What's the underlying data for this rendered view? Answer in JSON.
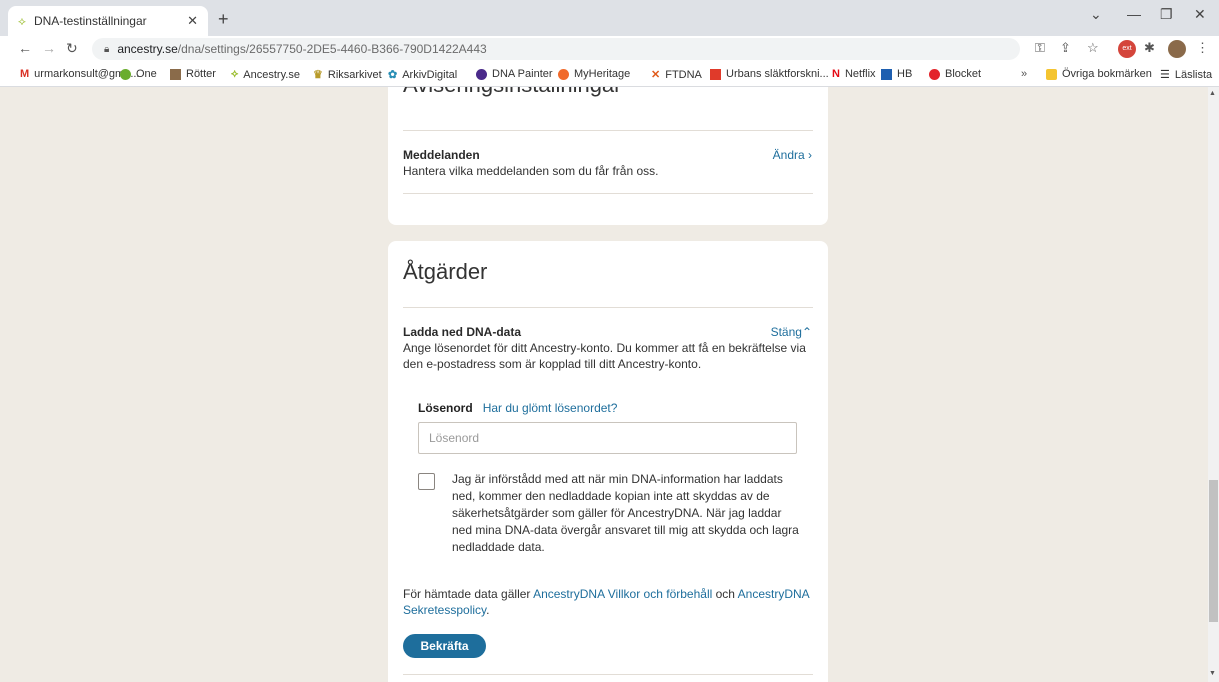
{
  "browser": {
    "tab_title": "DNA-testinställningar",
    "tab_favicon": "ancestry-leaf-icon",
    "url_host": "ancestry.se",
    "url_path": "/dna/settings/26557750-2DE5-4460-B366-790D1422A443",
    "bookmarks": [
      {
        "label": "urmarkonsult@gma...",
        "icon": "gmail-icon",
        "color": "#d93025"
      },
      {
        "label": "One",
        "icon": "circle-icon",
        "color": "#6aad2d"
      },
      {
        "label": "Rötter",
        "icon": "image-icon",
        "color": "#8a6b4a"
      },
      {
        "label": "Ancestry.se",
        "icon": "ancestry-leaf-icon",
        "color": "#9cbe30"
      },
      {
        "label": "Riksarkivet",
        "icon": "crown-icon",
        "color": "#b89b2a"
      },
      {
        "label": "ArkivDigital",
        "icon": "globe-icon",
        "color": "#2a8fb5"
      },
      {
        "label": "DNA Painter",
        "icon": "p-icon",
        "color": "#4a2a8a"
      },
      {
        "label": "MyHeritage",
        "icon": "myheritage-icon",
        "color": "#f16a2b"
      },
      {
        "label": "FTDNA",
        "icon": "ftdna-icon",
        "color": "#e05a1a"
      },
      {
        "label": "Urbans släktforskni...",
        "icon": "map-pin-icon",
        "color": "#e03a2a"
      },
      {
        "label": "Netflix",
        "icon": "netflix-icon",
        "color": "#e50914"
      },
      {
        "label": "HB",
        "icon": "hb-icon",
        "color": "#1e5fb0"
      },
      {
        "label": "Blocket",
        "icon": "blocket-icon",
        "color": "#e3242b"
      }
    ],
    "bookmarks_overflow": "»",
    "other_bookmarks": "Övriga bokmärken",
    "reading_list": "Läslista"
  },
  "notifications_section": {
    "heading": "Aviseringsinställningar",
    "row_title": "Meddelanden",
    "row_desc": "Hantera vilka meddelanden som du får från oss.",
    "row_action": "Ändra ›"
  },
  "actions_section": {
    "heading": "Åtgärder",
    "row_title": "Ladda ned DNA-data",
    "row_action": "Stäng⌃",
    "row_desc": "Ange lösenordet för ditt Ancestry-konto. Du kommer att få en bekräftelse via den e-postadress som är kopplad till ditt Ancestry-konto.",
    "password_label": "Lösenord",
    "forgot_link": "Har du glömt lösenordet?",
    "password_placeholder": "Lösenord",
    "consent_text": "Jag är införstådd med att när min DNA-information har laddats ned, kommer den nedladdade kopian inte att skyddas av de säkerhetsåtgärder som gäller för AncestryDNA. När jag laddar ned mina DNA-data övergår ansvaret till mig att skydda och lagra nedladdade data.",
    "consent_checked": false,
    "terms_prefix": "För hämtade data gäller ",
    "terms_link": "AncestryDNA Villkor och förbehåll",
    "terms_middle": " och ",
    "privacy_link": "AncestryDNA Sekretesspolicy",
    "terms_suffix": ".",
    "confirm_button": "Bekräfta"
  },
  "colors": {
    "page_bg": "#efebe4",
    "link": "#1e6e9c",
    "button": "#1e6e9c"
  }
}
